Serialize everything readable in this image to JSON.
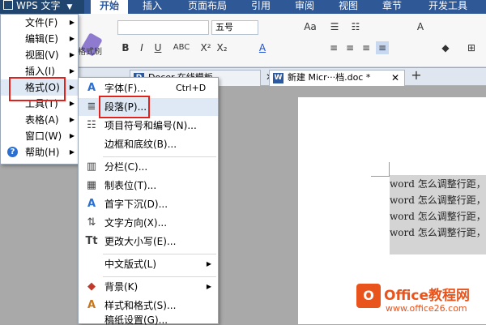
{
  "app": {
    "title": "WPS 文字"
  },
  "ribbon_tabs": [
    "开始",
    "插入",
    "页面布局",
    "引用",
    "审阅",
    "视图",
    "章节",
    "开发工具"
  ],
  "ribbon": {
    "format_painter_label": "格式刷",
    "font_size": "五号",
    "buttons": [
      "B",
      "I",
      "U",
      "ABC",
      "X²",
      "X₂",
      "A",
      "Aa"
    ]
  },
  "doc_tabs": [
    {
      "label": "Docer-在线模板"
    },
    {
      "label": "新建 Micr···档.doc *"
    }
  ],
  "main_menu": [
    {
      "label": "文件(F)",
      "has_submenu": true
    },
    {
      "label": "编辑(E)",
      "has_submenu": true
    },
    {
      "label": "视图(V)",
      "has_submenu": true
    },
    {
      "label": "插入(I)",
      "has_submenu": true
    },
    {
      "label": "格式(O)",
      "has_submenu": true,
      "highlighted": true
    },
    {
      "label": "工具(T)",
      "has_submenu": true
    },
    {
      "label": "表格(A)",
      "has_submenu": true
    },
    {
      "label": "窗口(W)",
      "has_submenu": true
    },
    {
      "label": "帮助(H)",
      "has_submenu": true
    }
  ],
  "format_menu": [
    {
      "icon": "font-icon",
      "label": "字体(F)...",
      "shortcut": "Ctrl+D"
    },
    {
      "icon": "paragraph-icon",
      "label": "段落(P)...",
      "highlighted": true
    },
    {
      "icon": "list-icon",
      "label": "项目符号和编号(N)..."
    },
    {
      "icon": "",
      "label": "边框和底纹(B)..."
    },
    {
      "icon": "columns-icon",
      "label": "分栏(C)..."
    },
    {
      "icon": "tab-stops-icon",
      "label": "制表位(T)..."
    },
    {
      "icon": "drop-cap-icon",
      "label": "首字下沉(D)..."
    },
    {
      "icon": "text-direction-icon",
      "label": "文字方向(X)..."
    },
    {
      "icon": "change-case-icon",
      "label": "更改大小写(E)..."
    },
    {
      "icon": "",
      "label": "中文版式(L)",
      "has_submenu": true
    },
    {
      "icon": "background-icon",
      "label": "背景(K)",
      "has_submenu": true
    },
    {
      "icon": "styles-icon",
      "label": "样式和格式(S)..."
    },
    {
      "icon": "",
      "label": "稿纸设置(G)..."
    }
  ],
  "document": {
    "lines": [
      "word 怎么调整行距，",
      "word 怎么调整行距，",
      "word 怎么调整行距，",
      "word 怎么调整行距，"
    ]
  },
  "watermark": {
    "title": "Office教程网",
    "url": "www.office26.com"
  }
}
